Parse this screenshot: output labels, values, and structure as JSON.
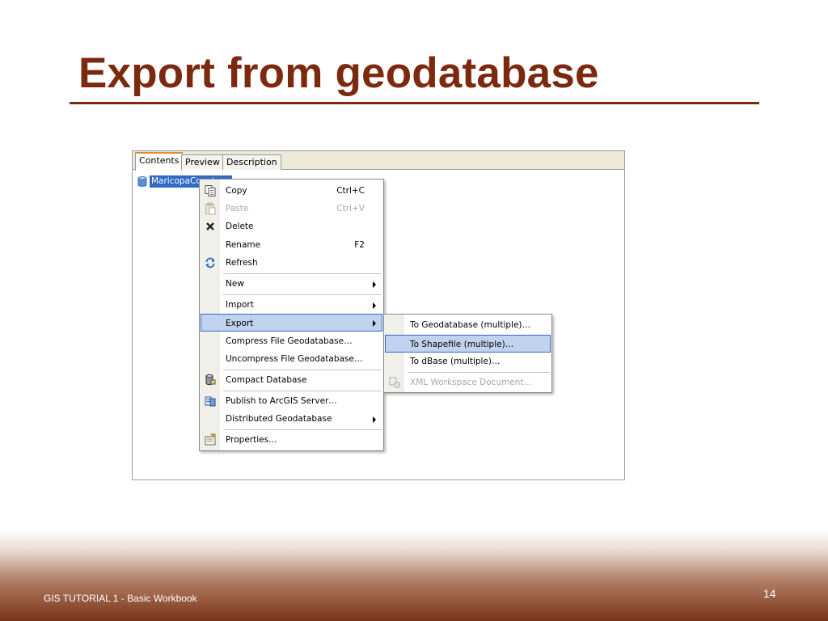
{
  "slide": {
    "title": "Export from geodatabase",
    "footer": "GIS TUTORIAL 1 - Basic Workbook",
    "page_number": "14"
  },
  "catalog": {
    "tabs": [
      {
        "label": "Contents",
        "active": true
      },
      {
        "label": "Preview",
        "active": false
      },
      {
        "label": "Description",
        "active": false
      }
    ],
    "tree_item": {
      "label": "MaricopaCounty.mdb",
      "icon": "database-icon",
      "selected": true
    }
  },
  "context_menu": {
    "items": [
      {
        "label": "Copy",
        "shortcut": "Ctrl+C",
        "icon": "copy-icon",
        "enabled": true
      },
      {
        "label": "Paste",
        "shortcut": "Ctrl+V",
        "icon": "paste-icon",
        "enabled": false
      },
      {
        "label": "Delete",
        "shortcut": "",
        "icon": "delete-icon",
        "enabled": true
      },
      {
        "label": "Rename",
        "shortcut": "F2",
        "icon": "",
        "enabled": true
      },
      {
        "label": "Refresh",
        "shortcut": "",
        "icon": "refresh-icon",
        "enabled": true
      },
      {
        "label": "New",
        "submenu": true,
        "enabled": true
      },
      {
        "label": "Import",
        "submenu": true,
        "enabled": true
      },
      {
        "label": "Export",
        "submenu": true,
        "enabled": true,
        "highlighted": true
      },
      {
        "label": "Compress File Geodatabase…",
        "enabled": true
      },
      {
        "label": "Uncompress File Geodatabase…",
        "enabled": true
      },
      {
        "label": "Compact Database",
        "icon": "compact-database-icon",
        "enabled": true
      },
      {
        "label": "Publish to ArcGIS Server…",
        "icon": "publish-icon",
        "enabled": true
      },
      {
        "label": "Distributed Geodatabase",
        "submenu": true,
        "enabled": true
      },
      {
        "label": "Properties…",
        "icon": "properties-icon",
        "enabled": true
      }
    ]
  },
  "export_submenu": {
    "items": [
      {
        "label": "To Geodatabase (multiple)…",
        "enabled": true
      },
      {
        "label": "To Shapefile (multiple)…",
        "enabled": true,
        "highlighted": true
      },
      {
        "label": "To dBase (multiple)…",
        "enabled": true
      },
      {
        "label": "XML Workspace Document…",
        "icon": "xml-workspace-icon",
        "enabled": false
      }
    ]
  },
  "colors": {
    "title": "#7b2a0f",
    "selection": "#316ac5",
    "menu_highlight": "#c1d2ee"
  }
}
